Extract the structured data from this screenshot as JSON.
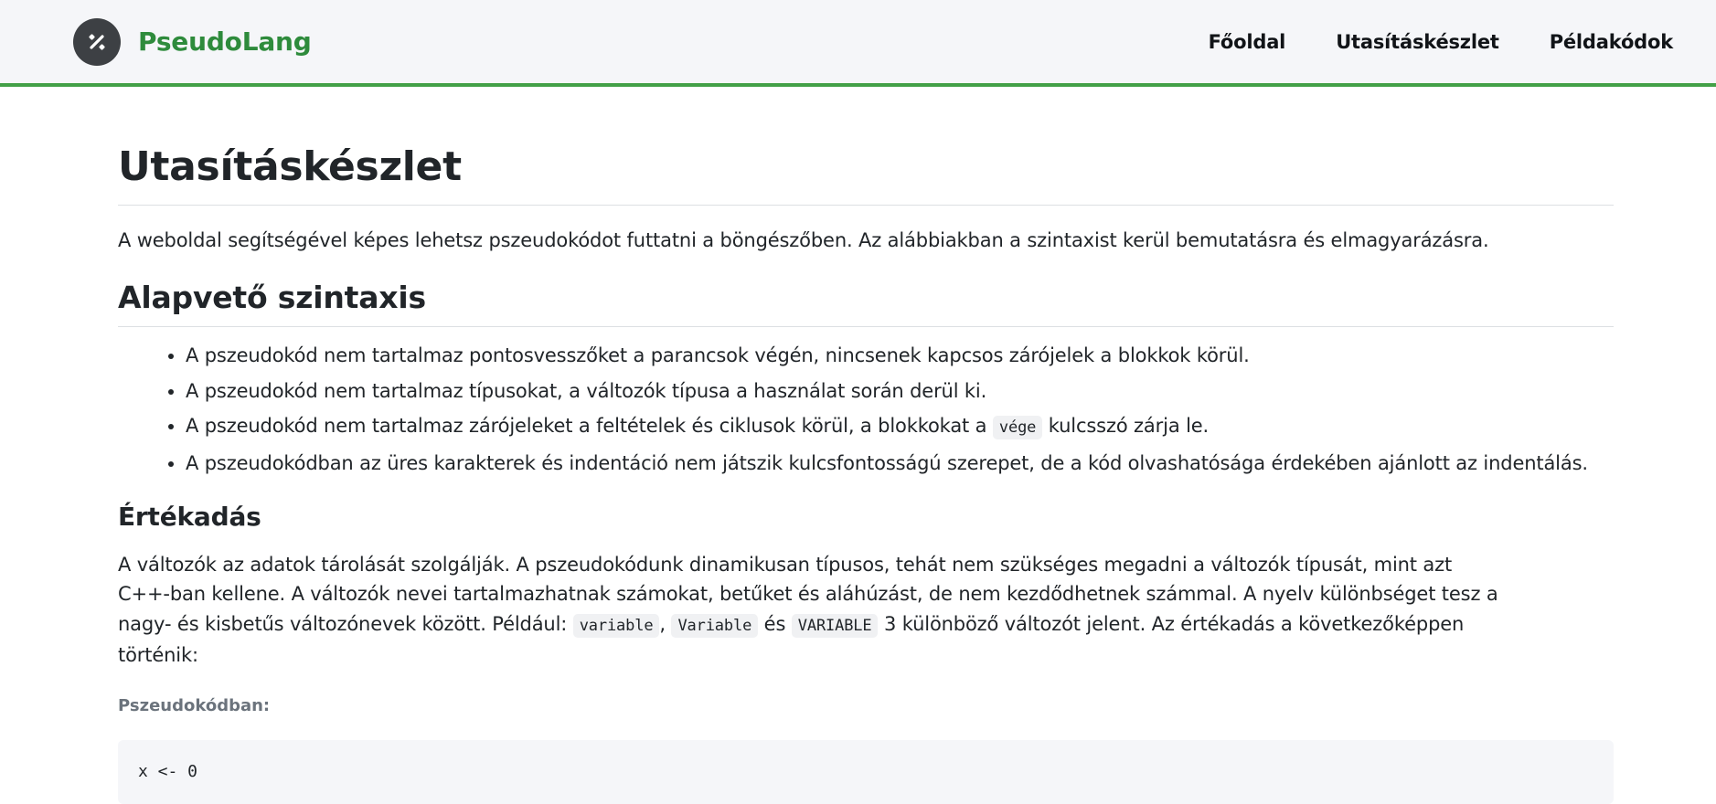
{
  "header": {
    "logo_icon": "percent-icon",
    "brand": "PseudoLang",
    "nav": [
      {
        "label": "Főoldal"
      },
      {
        "label": "Utasításkészlet"
      },
      {
        "label": "Példakódok"
      }
    ]
  },
  "page": {
    "title": "Utasításkészlet",
    "intro": "A weboldal segítségével képes lehetsz pszeudokódot futtatni a böngészőben. Az alábbiakban a szintaxist kerül bemutatásra és elmagyarázásra."
  },
  "basic": {
    "title": "Alapvető szintaxis",
    "items": [
      "A pszeudokód nem tartalmaz pontosvesszőket a parancsok végén, nincsenek kapcsos zárójelek a blokkok körül.",
      "A pszeudokód nem tartalmaz típusokat, a változók típusa a használat során derül ki.",
      {
        "before": "A pszeudokód nem tartalmaz zárójeleket a feltételek és ciklusok körül, a blokkokat a ",
        "code": "vége",
        "after": " kulcsszó zárja le."
      },
      "A pszeudokódban az üres karakterek és indentáció nem játszik kulcsfontosságú szerepet, de a kód olvashatósága érdekében ajánlott az indentálás."
    ]
  },
  "assignment": {
    "title": "Értékadás",
    "para_text": "A változók az adatok tárolását szolgálják. A pszeudokódunk dinamikusan típusos, tehát nem szükséges megadni a változók típusát, mint azt C++-ban kellene. A változók nevei tartalmazhatnak számokat, betűket és aláhúzást, de nem kezdődhetnek számmal. A nyelv különbséget tesz a nagy- és kisbetűs változónevek között. Például: ",
    "code1": "variable",
    "sep1": ", ",
    "code2": "Variable",
    "sep2": " és ",
    "code3": "VARIABLE",
    "para_end": " 3 különböző változót jelent. Az értékadás a következőképpen történik:",
    "code_label": "Pszeudokódban:",
    "code": "x <- 0"
  },
  "colors": {
    "accent": "#43a047",
    "brand": "#2e8b3c",
    "header_bg": "#f5f6f9",
    "code_bg": "#f5f6f9"
  }
}
